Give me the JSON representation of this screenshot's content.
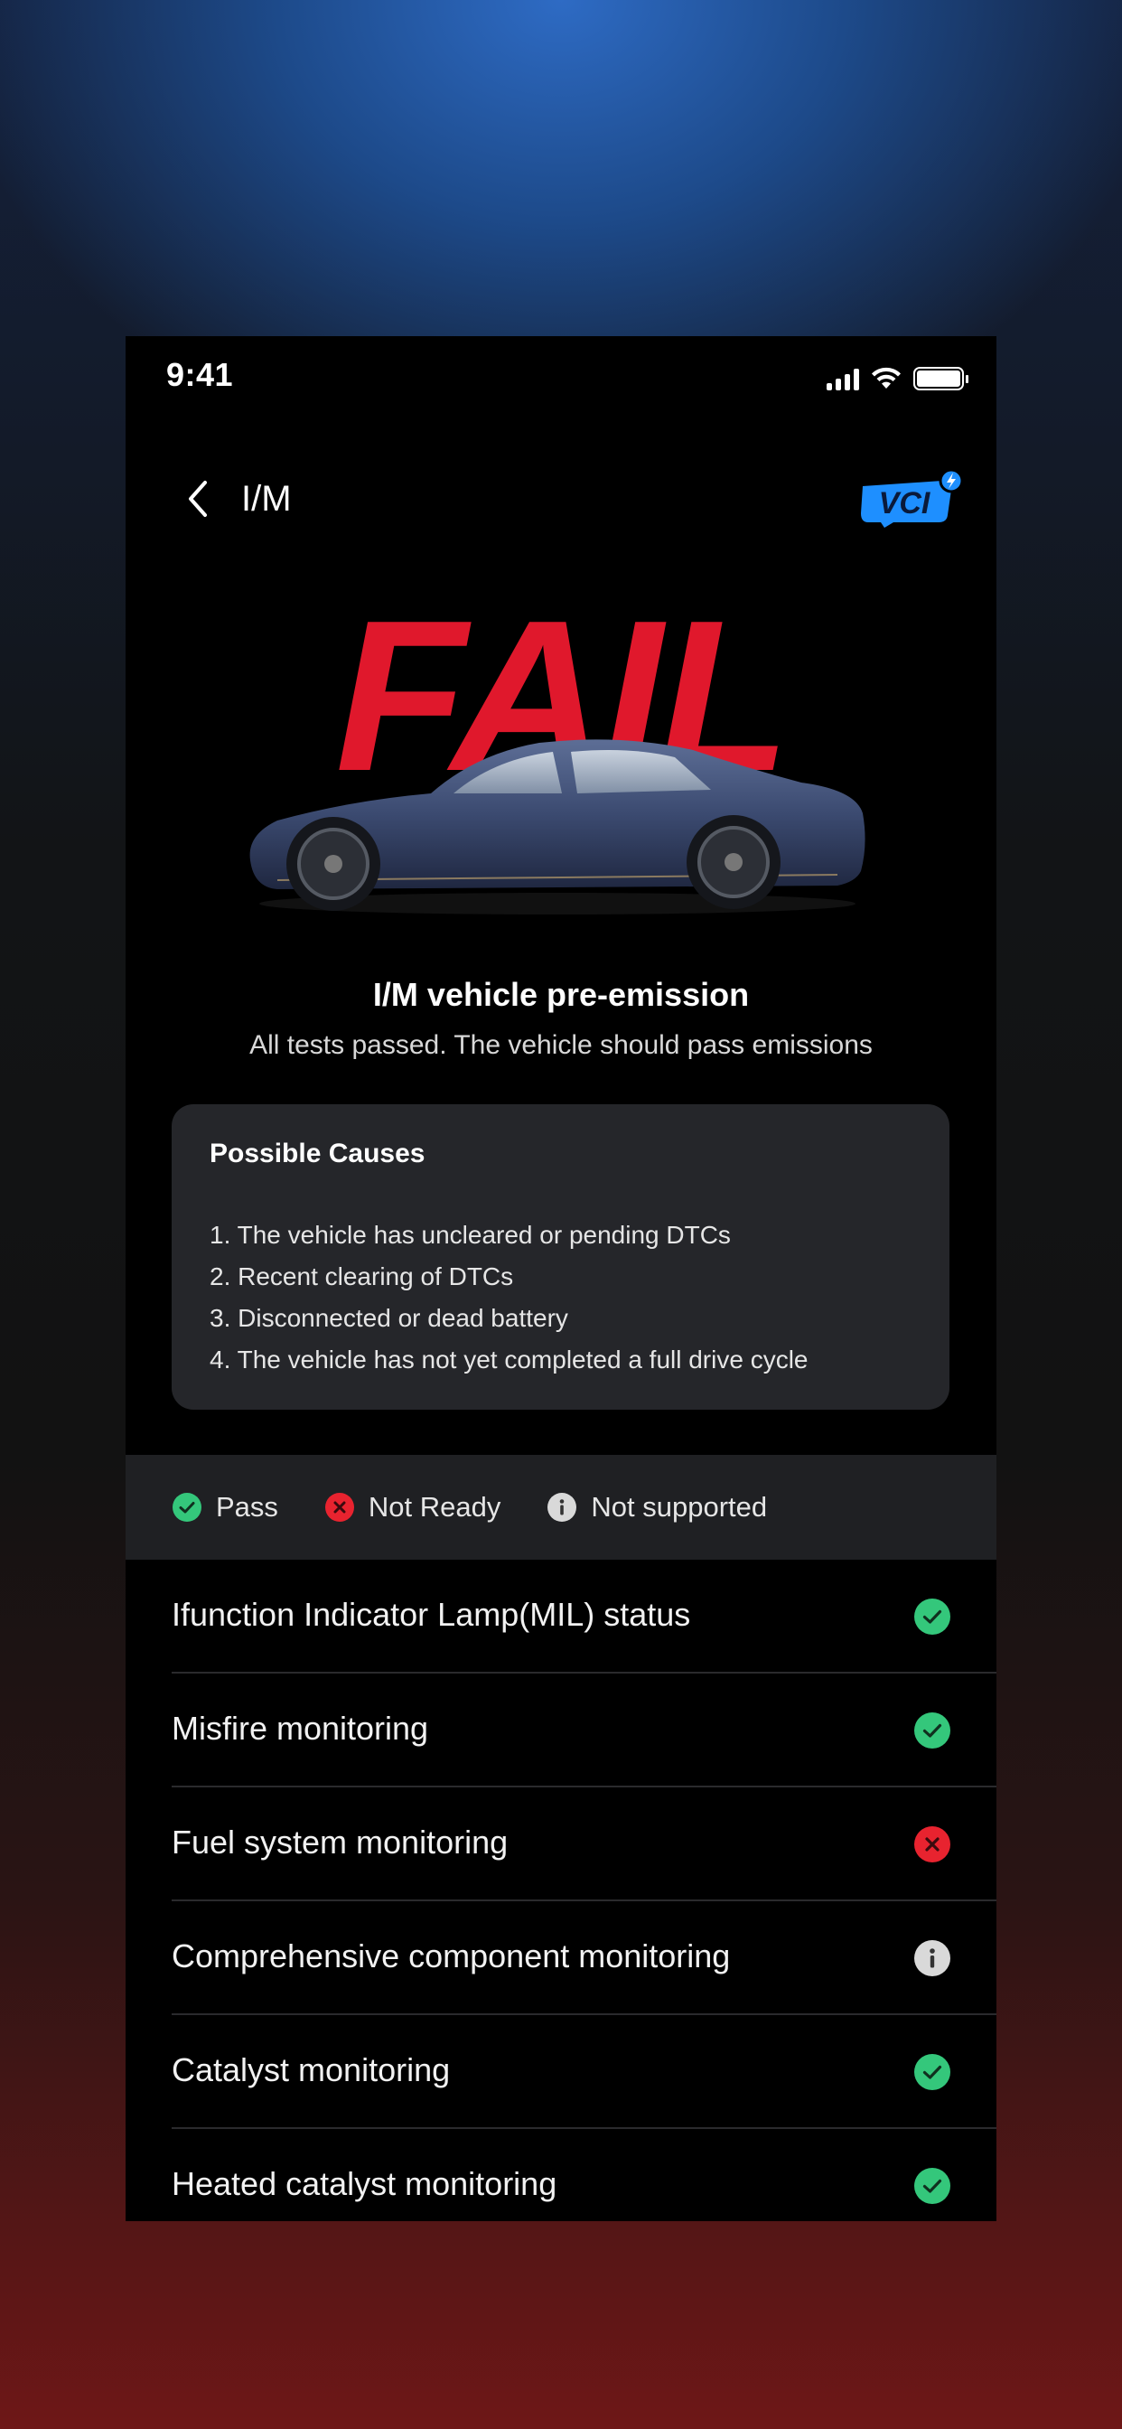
{
  "status_bar": {
    "time": "9:41"
  },
  "nav": {
    "title": "I/M",
    "brand": "VCI"
  },
  "hero": {
    "result": "FAIL",
    "headline": "I/M vehicle pre-emission",
    "subline": "All tests passed. The vehicle should pass emissions"
  },
  "causes": {
    "title": "Possible Causes",
    "items": [
      "1. The vehicle has uncleared or pending DTCs",
      "2. Recent clearing of DTCs",
      "3. Disconnected or dead battery",
      "4. The vehicle has not yet completed a full drive cycle"
    ]
  },
  "legend": {
    "pass": "Pass",
    "not_ready": "Not Ready",
    "not_supported": "Not supported"
  },
  "monitors": [
    {
      "label": "Ifunction Indicator Lamp(MIL) status",
      "status": "pass"
    },
    {
      "label": "Misfire monitoring",
      "status": "pass"
    },
    {
      "label": "Fuel system monitoring",
      "status": "not_ready"
    },
    {
      "label": "Comprehensive component monitoring",
      "status": "not_supported"
    },
    {
      "label": "Catalyst monitoring",
      "status": "pass"
    },
    {
      "label": "Heated catalyst monitoring",
      "status": "pass"
    }
  ],
  "colors": {
    "fail_red": "#e0182c",
    "pass_green": "#34c77b",
    "not_ready_red": "#e8232f",
    "not_supported_gray": "#d9d9d9",
    "brand_blue": "#1e8fff"
  }
}
